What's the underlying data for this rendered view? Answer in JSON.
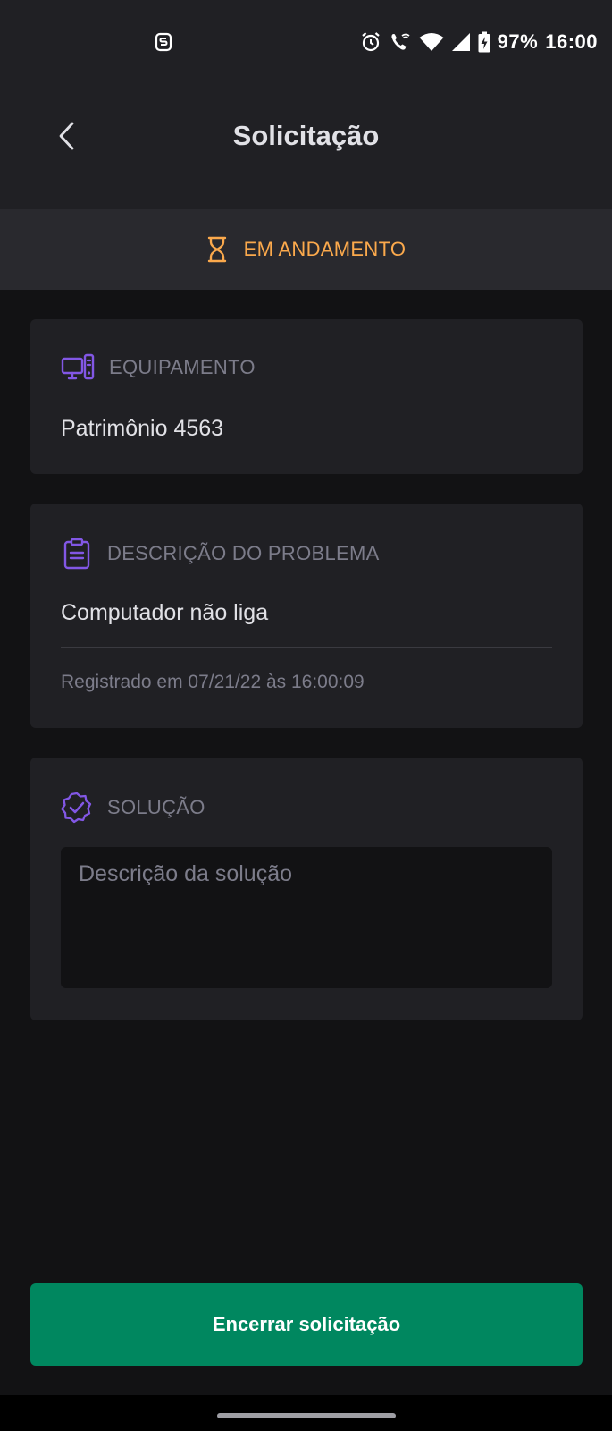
{
  "status_bar": {
    "battery_percent": "97%",
    "time": "16:00",
    "icons": [
      "app-notification-icon",
      "alarm-icon",
      "wifi-calling-icon",
      "wifi-icon",
      "signal-icon",
      "battery-charging-icon"
    ]
  },
  "header": {
    "title": "Solicitação",
    "back_icon": "chevron-left-icon"
  },
  "status": {
    "label": "EM ANDAMENTO",
    "icon": "hourglass-icon",
    "color": "#FBA94C"
  },
  "equipment": {
    "label": "EQUIPAMENTO",
    "icon": "desktop-computer-icon",
    "value": "Patrimônio 4563"
  },
  "problem": {
    "label": "DESCRIÇÃO DO PROBLEMA",
    "icon": "clipboard-icon",
    "value": "Computador não liga",
    "registered": "Registrado em 07/21/22 às 16:00:09"
  },
  "solution": {
    "label": "SOLUÇÃO",
    "icon": "check-badge-icon",
    "placeholder": "Descrição da solução"
  },
  "action": {
    "label": "Encerrar solicitação"
  },
  "colors": {
    "accent": "#8257E5",
    "success": "#00875F",
    "warning": "#FBA94C",
    "background": "#121214",
    "surface": "#202024"
  }
}
